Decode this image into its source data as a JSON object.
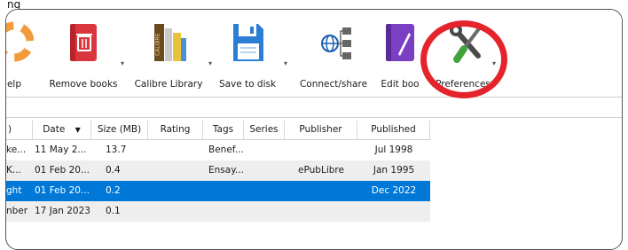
{
  "caption": "ng",
  "toolbar": {
    "help_label": "elp",
    "remove_label": "Remove books",
    "library_label": "Calibre Library",
    "save_label": "Save to disk",
    "connect_label": "Connect/share",
    "edit_label": "Edit boo",
    "prefs_label": "Preferences",
    "library_spine_text": "CALIBRE"
  },
  "table": {
    "headers": [
      ")",
      "Date",
      "Size (MB)",
      "Rating",
      "Tags",
      "Series",
      "Publisher",
      "Published"
    ],
    "rows": [
      {
        "c0": "ke...",
        "date": "11 May 2...",
        "size": "13.7",
        "rating": "",
        "tags": "Benef...",
        "series": "",
        "publisher": "",
        "published": "Jul 1998"
      },
      {
        "c0": "K...",
        "date": "01 Feb 20...",
        "size": "0.4",
        "rating": "",
        "tags": "Ensay...",
        "series": "",
        "publisher": "ePubLibre",
        "published": "Jan 1995"
      },
      {
        "c0": "ght",
        "date": "01 Feb 20...",
        "size": "0.2",
        "rating": "",
        "tags": "",
        "series": "",
        "publisher": "",
        "published": "Dec 2022"
      },
      {
        "c0": "nber",
        "date": "17 Jan 2023",
        "size": "0.1",
        "rating": "",
        "tags": "",
        "series": "",
        "publisher": "",
        "published": ""
      }
    ]
  },
  "colors": {
    "accent": "#0078d7",
    "highlight_ring": "#e5232a"
  }
}
